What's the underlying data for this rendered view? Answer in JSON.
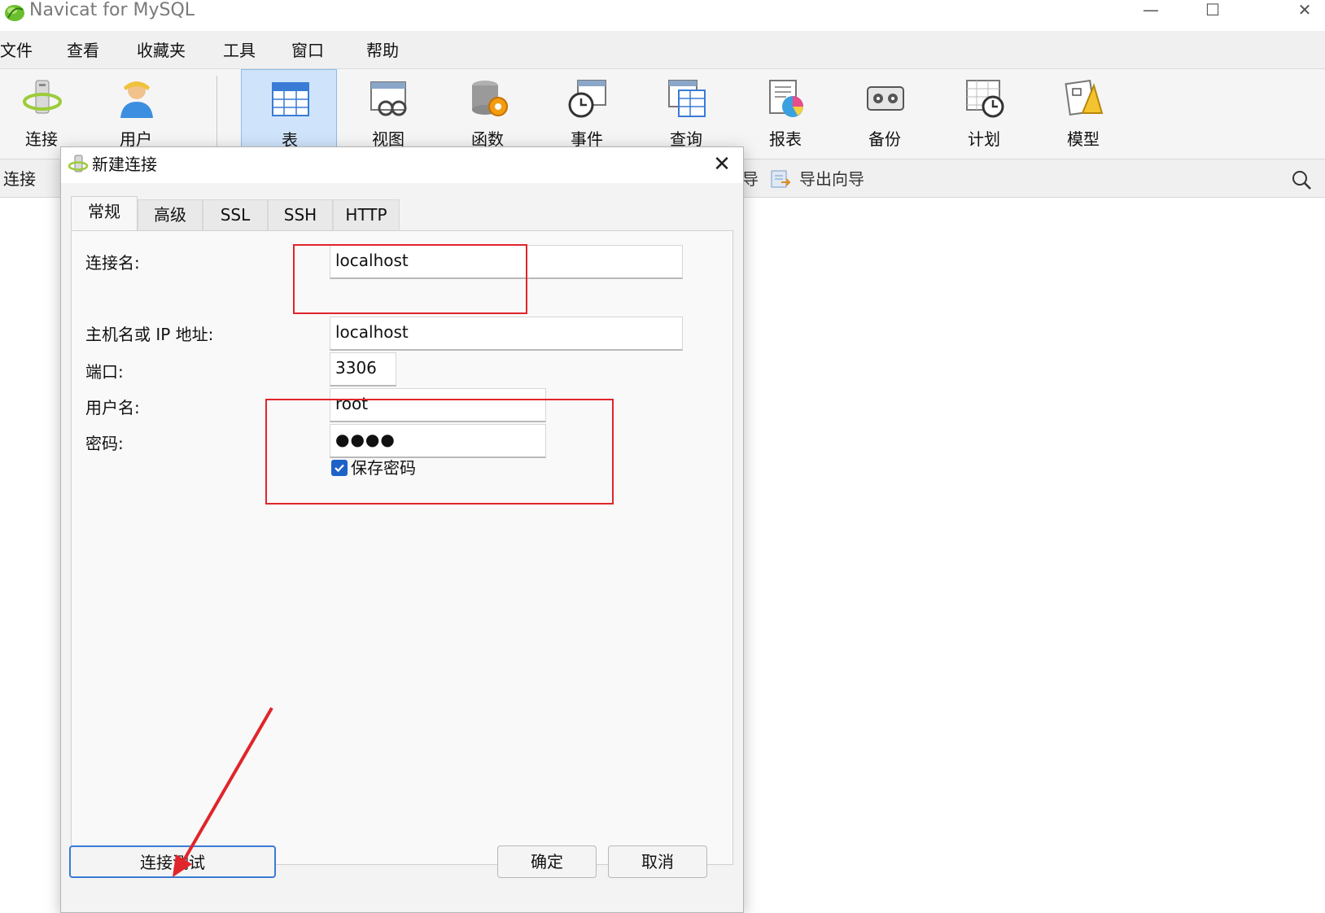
{
  "window": {
    "title": "Navicat for MySQL",
    "controls": {
      "minimize": "—",
      "maximize": "☐",
      "close": "✕"
    }
  },
  "menu": [
    "文件",
    "查看",
    "收藏夹",
    "工具",
    "窗口",
    "帮助"
  ],
  "toolbar": {
    "items": [
      {
        "label": "连接",
        "icon": "connection-icon"
      },
      {
        "label": "用户",
        "icon": "user-icon"
      },
      {
        "label": "表",
        "icon": "table-icon",
        "active": true
      },
      {
        "label": "视图",
        "icon": "view-icon"
      },
      {
        "label": "函数",
        "icon": "function-icon"
      },
      {
        "label": "事件",
        "icon": "event-icon"
      },
      {
        "label": "查询",
        "icon": "query-icon"
      },
      {
        "label": "报表",
        "icon": "report-icon"
      },
      {
        "label": "备份",
        "icon": "backup-icon"
      },
      {
        "label": "计划",
        "icon": "schedule-icon"
      },
      {
        "label": "模型",
        "icon": "model-icon"
      }
    ]
  },
  "objectbar": {
    "connection_label": "连接",
    "partial_label": "导",
    "export_wizard": "导出向导"
  },
  "dialog": {
    "title": "新建连接",
    "close": "✕",
    "tabs": [
      "常规",
      "高级",
      "SSL",
      "SSH",
      "HTTP"
    ],
    "active_tab": "常规",
    "fields": {
      "connection_name": {
        "label": "连接名:",
        "value": "localhost"
      },
      "host": {
        "label": "主机名或 IP 地址:",
        "value": "localhost"
      },
      "port": {
        "label": "端口:",
        "value": "3306"
      },
      "username": {
        "label": "用户名:",
        "value": "root"
      },
      "password": {
        "label": "密码:",
        "value": "●●●●"
      },
      "save_password": {
        "label": "保存密码",
        "checked": true
      }
    },
    "buttons": {
      "test": "连接测试",
      "ok": "确定",
      "cancel": "取消"
    }
  },
  "annotations": {
    "color": "#e0252b"
  },
  "colors": {
    "active_tab_bg": "#cfe4fb",
    "checkbox": "#1e62c8"
  }
}
